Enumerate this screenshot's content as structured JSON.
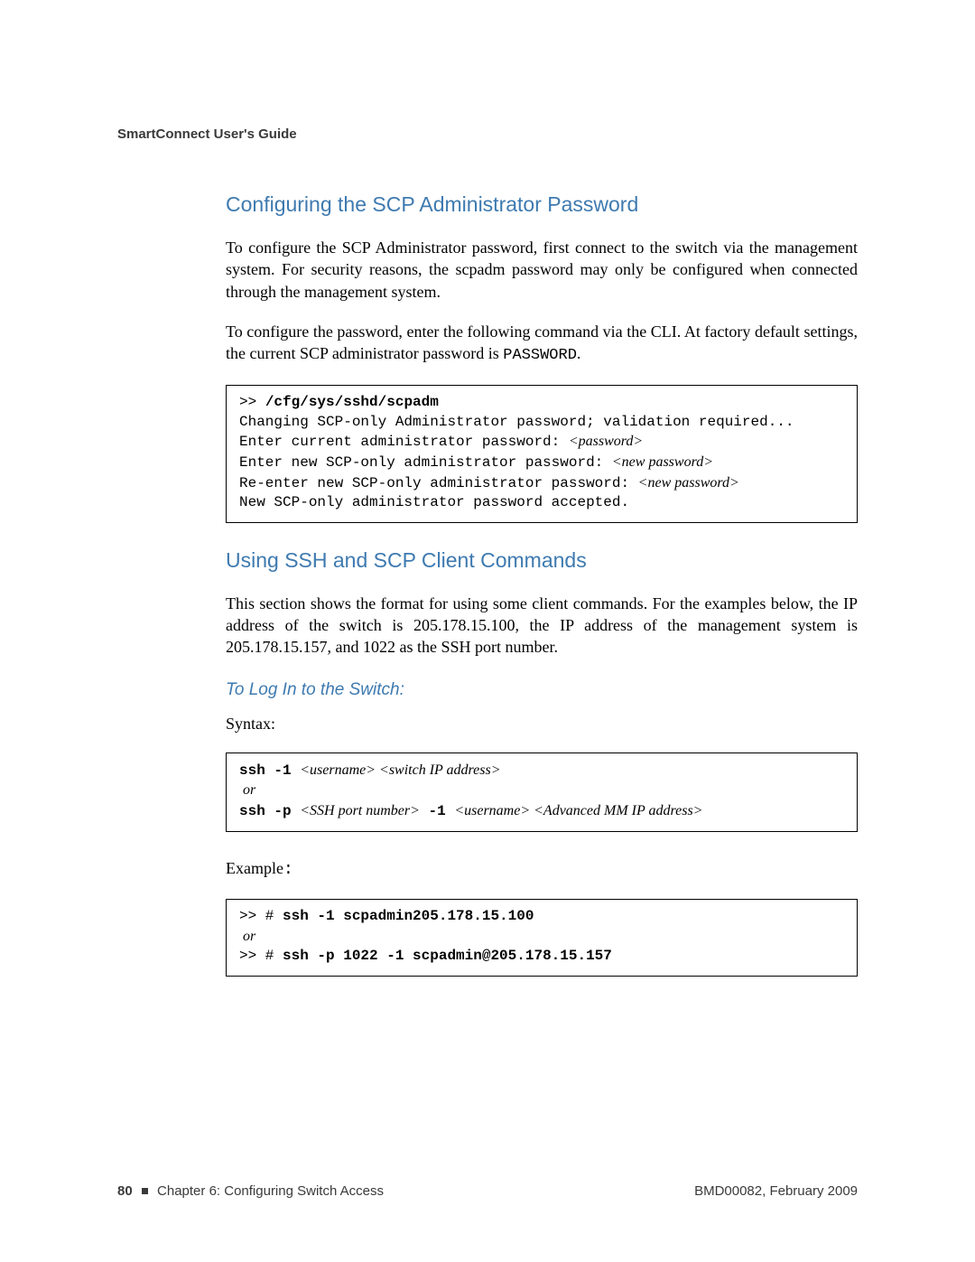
{
  "header": {
    "title": "SmartConnect User's Guide"
  },
  "section1": {
    "heading": "Configuring the SCP Administrator Password",
    "para1": "To configure the SCP Administrator password, first connect to the switch via the management system. For security reasons, the scpadm password may only be configured when connected through the management system.",
    "para2a": "To configure the password, enter the following command via the CLI. At factory default settings, the current SCP administrator password is ",
    "para2_code": "PASSWORD",
    "para2b": ".",
    "code": {
      "l1a": ">> ",
      "l1b": "/cfg/sys/sshd/scpadm",
      "l2": "Changing SCP-only Administrator password; validation required...",
      "l3a": "Enter current administrator password: ",
      "l3i": "<password>",
      "l4a": "Enter new SCP-only administrator password: ",
      "l4i": "<new password>",
      "l5a": "Re-enter new SCP-only administrator password: ",
      "l5i": "<new password>",
      "l6": "New SCP-only administrator password accepted."
    }
  },
  "section2": {
    "heading": "Using SSH and SCP Client Commands",
    "para1": "This section shows the format for using some client commands. For the examples below, the IP address of the switch is 205.178.15.100, the IP address of the management system is 205.178.15.157, and 1022 as the SSH port number.",
    "sub1": {
      "heading": "To Log In to the Switch:",
      "syntax_label": "Syntax:",
      "syntax": {
        "l1a": "ssh -1 ",
        "l1i": "<username> <switch IP address>",
        "l2i": " or",
        "l3a": "ssh -p ",
        "l3i1": "<SSH port number>",
        "l3b": " -1 ",
        "l3i2": "<username> <Advanced MM IP address>"
      },
      "example_label_a": "Example",
      "example_label_b": ":",
      "example": {
        "l1a": ">> # ",
        "l1b": "ssh -1 scpadmin205.178.15.100",
        "l2i": " or",
        "l3a": ">> # ",
        "l3b": "ssh -p 1022 -1 scpadmin@205.178.15.157"
      }
    }
  },
  "footer": {
    "page": "80",
    "chapter": "Chapter 6: Configuring Switch Access",
    "docid": "BMD00082, February 2009"
  }
}
